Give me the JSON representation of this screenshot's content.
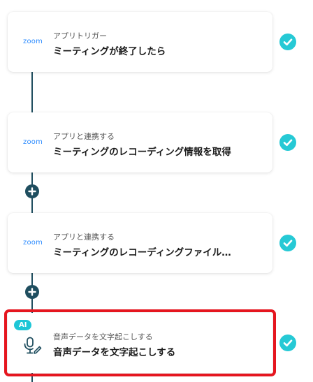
{
  "steps": [
    {
      "app": "zoom",
      "label": "アプリトリガー",
      "title": "ミーティングが終了したら",
      "status_icon": "check-circle-icon"
    },
    {
      "app": "zoom",
      "label": "アプリと連携する",
      "title": "ミーティングのレコーディング情報を取得",
      "status_icon": "check-circle-icon"
    },
    {
      "app": "zoom",
      "label": "アプリと連携する",
      "title": "ミーティングのレコーディングファイル…",
      "status_icon": "check-circle-icon"
    },
    {
      "badge": "AI",
      "icon": "microphone-pen-icon",
      "label": "音声データを文字起こしする",
      "title": "音声データを文字起こしする",
      "status_icon": "check-circle-icon"
    }
  ],
  "colors": {
    "accent": "#26c9d5",
    "connector": "#1f4e5f",
    "zoom_brand": "#2d8cff",
    "highlight": "#e5161f"
  }
}
